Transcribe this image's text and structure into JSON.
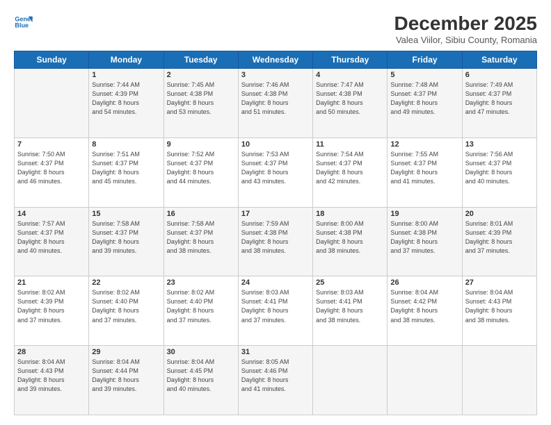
{
  "header": {
    "logo_line1": "General",
    "logo_line2": "Blue",
    "month_title": "December 2025",
    "subtitle": "Valea Viilor, Sibiu County, Romania"
  },
  "days_of_week": [
    "Sunday",
    "Monday",
    "Tuesday",
    "Wednesday",
    "Thursday",
    "Friday",
    "Saturday"
  ],
  "weeks": [
    [
      {
        "day": "",
        "info": ""
      },
      {
        "day": "1",
        "info": "Sunrise: 7:44 AM\nSunset: 4:39 PM\nDaylight: 8 hours\nand 54 minutes."
      },
      {
        "day": "2",
        "info": "Sunrise: 7:45 AM\nSunset: 4:38 PM\nDaylight: 8 hours\nand 53 minutes."
      },
      {
        "day": "3",
        "info": "Sunrise: 7:46 AM\nSunset: 4:38 PM\nDaylight: 8 hours\nand 51 minutes."
      },
      {
        "day": "4",
        "info": "Sunrise: 7:47 AM\nSunset: 4:38 PM\nDaylight: 8 hours\nand 50 minutes."
      },
      {
        "day": "5",
        "info": "Sunrise: 7:48 AM\nSunset: 4:37 PM\nDaylight: 8 hours\nand 49 minutes."
      },
      {
        "day": "6",
        "info": "Sunrise: 7:49 AM\nSunset: 4:37 PM\nDaylight: 8 hours\nand 47 minutes."
      }
    ],
    [
      {
        "day": "7",
        "info": "Sunrise: 7:50 AM\nSunset: 4:37 PM\nDaylight: 8 hours\nand 46 minutes."
      },
      {
        "day": "8",
        "info": "Sunrise: 7:51 AM\nSunset: 4:37 PM\nDaylight: 8 hours\nand 45 minutes."
      },
      {
        "day": "9",
        "info": "Sunrise: 7:52 AM\nSunset: 4:37 PM\nDaylight: 8 hours\nand 44 minutes."
      },
      {
        "day": "10",
        "info": "Sunrise: 7:53 AM\nSunset: 4:37 PM\nDaylight: 8 hours\nand 43 minutes."
      },
      {
        "day": "11",
        "info": "Sunrise: 7:54 AM\nSunset: 4:37 PM\nDaylight: 8 hours\nand 42 minutes."
      },
      {
        "day": "12",
        "info": "Sunrise: 7:55 AM\nSunset: 4:37 PM\nDaylight: 8 hours\nand 41 minutes."
      },
      {
        "day": "13",
        "info": "Sunrise: 7:56 AM\nSunset: 4:37 PM\nDaylight: 8 hours\nand 40 minutes."
      }
    ],
    [
      {
        "day": "14",
        "info": "Sunrise: 7:57 AM\nSunset: 4:37 PM\nDaylight: 8 hours\nand 40 minutes."
      },
      {
        "day": "15",
        "info": "Sunrise: 7:58 AM\nSunset: 4:37 PM\nDaylight: 8 hours\nand 39 minutes."
      },
      {
        "day": "16",
        "info": "Sunrise: 7:58 AM\nSunset: 4:37 PM\nDaylight: 8 hours\nand 38 minutes."
      },
      {
        "day": "17",
        "info": "Sunrise: 7:59 AM\nSunset: 4:38 PM\nDaylight: 8 hours\nand 38 minutes."
      },
      {
        "day": "18",
        "info": "Sunrise: 8:00 AM\nSunset: 4:38 PM\nDaylight: 8 hours\nand 38 minutes."
      },
      {
        "day": "19",
        "info": "Sunrise: 8:00 AM\nSunset: 4:38 PM\nDaylight: 8 hours\nand 37 minutes."
      },
      {
        "day": "20",
        "info": "Sunrise: 8:01 AM\nSunset: 4:39 PM\nDaylight: 8 hours\nand 37 minutes."
      }
    ],
    [
      {
        "day": "21",
        "info": "Sunrise: 8:02 AM\nSunset: 4:39 PM\nDaylight: 8 hours\nand 37 minutes."
      },
      {
        "day": "22",
        "info": "Sunrise: 8:02 AM\nSunset: 4:40 PM\nDaylight: 8 hours\nand 37 minutes."
      },
      {
        "day": "23",
        "info": "Sunrise: 8:02 AM\nSunset: 4:40 PM\nDaylight: 8 hours\nand 37 minutes."
      },
      {
        "day": "24",
        "info": "Sunrise: 8:03 AM\nSunset: 4:41 PM\nDaylight: 8 hours\nand 37 minutes."
      },
      {
        "day": "25",
        "info": "Sunrise: 8:03 AM\nSunset: 4:41 PM\nDaylight: 8 hours\nand 38 minutes."
      },
      {
        "day": "26",
        "info": "Sunrise: 8:04 AM\nSunset: 4:42 PM\nDaylight: 8 hours\nand 38 minutes."
      },
      {
        "day": "27",
        "info": "Sunrise: 8:04 AM\nSunset: 4:43 PM\nDaylight: 8 hours\nand 38 minutes."
      }
    ],
    [
      {
        "day": "28",
        "info": "Sunrise: 8:04 AM\nSunset: 4:43 PM\nDaylight: 8 hours\nand 39 minutes."
      },
      {
        "day": "29",
        "info": "Sunrise: 8:04 AM\nSunset: 4:44 PM\nDaylight: 8 hours\nand 39 minutes."
      },
      {
        "day": "30",
        "info": "Sunrise: 8:04 AM\nSunset: 4:45 PM\nDaylight: 8 hours\nand 40 minutes."
      },
      {
        "day": "31",
        "info": "Sunrise: 8:05 AM\nSunset: 4:46 PM\nDaylight: 8 hours\nand 41 minutes."
      },
      {
        "day": "",
        "info": ""
      },
      {
        "day": "",
        "info": ""
      },
      {
        "day": "",
        "info": ""
      }
    ]
  ]
}
